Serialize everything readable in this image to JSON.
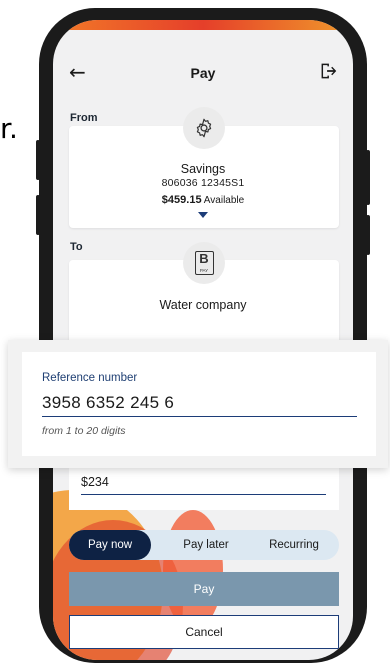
{
  "edge_text": "r.",
  "appbar": {
    "title": "Pay",
    "back_icon": "arrow-left-icon",
    "logout_icon": "logout-icon"
  },
  "from": {
    "label": "From",
    "icon": "gear-icon",
    "account_name": "Savings",
    "account_number": "806036  12345S1",
    "balance": "$459.15",
    "balance_suffix": "Available"
  },
  "to": {
    "label": "To",
    "icon": "bpay-icon",
    "icon_text": "PAY",
    "payee_name": "Water company"
  },
  "reference": {
    "label": "Reference number",
    "value": "3958 6352 245 6",
    "hint": "from 1 to 20 digits"
  },
  "amount": {
    "value": "$234"
  },
  "timing_tabs": [
    {
      "label": "Pay now",
      "active": true
    },
    {
      "label": "Pay later",
      "active": false
    },
    {
      "label": "Recurring",
      "active": false
    }
  ],
  "actions": {
    "pay_label": "Pay",
    "cancel_label": "Cancel"
  },
  "colors": {
    "primary": "#0e2244",
    "accent": "#1c3c78",
    "pay_button": "#7a97ad",
    "segment_bg": "#dce8f2",
    "deco_orange": "#f27a28"
  }
}
